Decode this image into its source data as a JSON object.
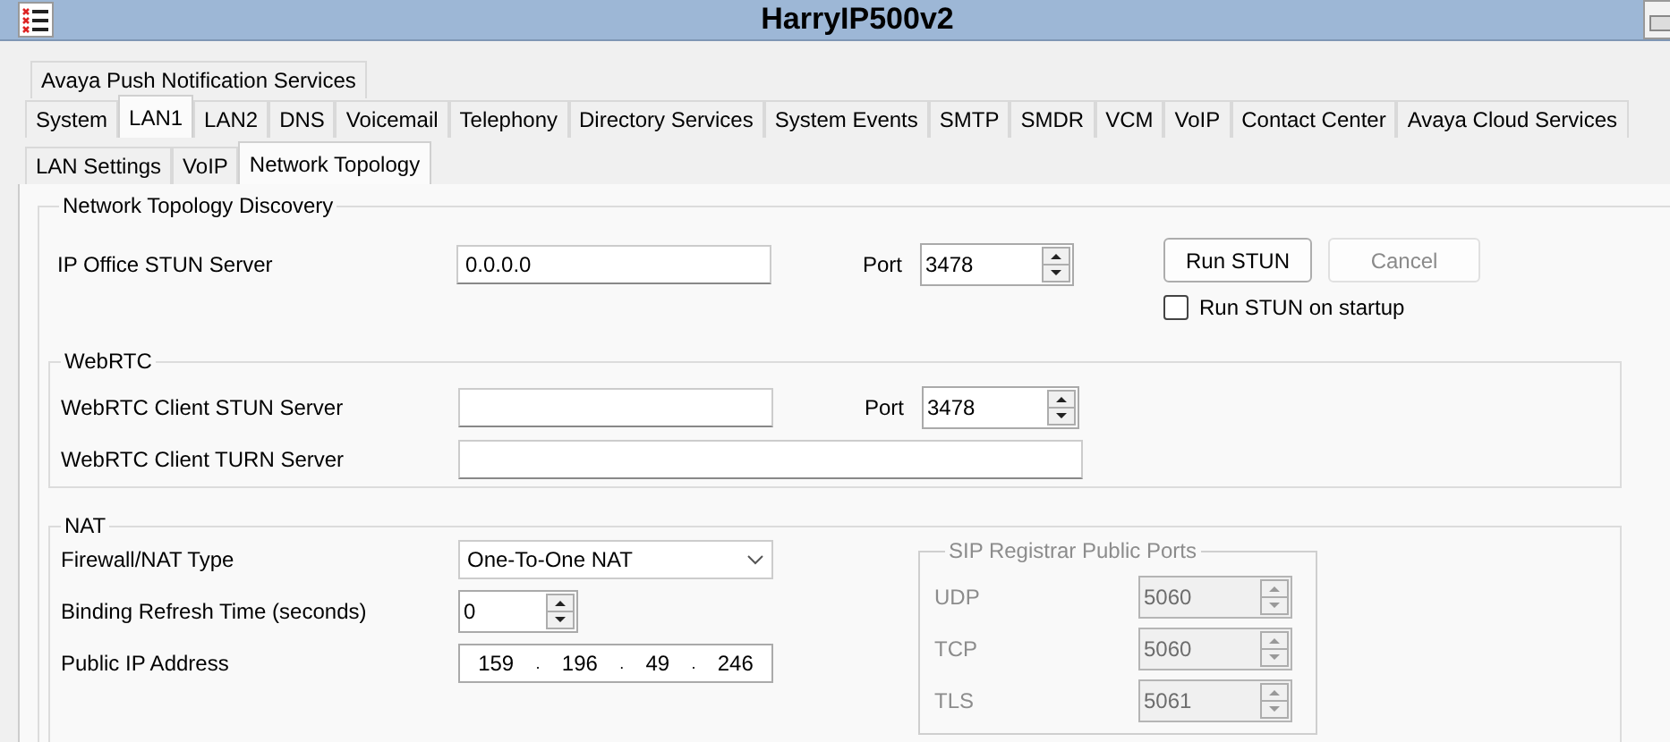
{
  "window": {
    "title": "HarryIP500v2"
  },
  "tab_rows": [
    [
      {
        "label": "Avaya Push Notification Services",
        "selected": false
      }
    ],
    [
      {
        "label": "System",
        "selected": false
      },
      {
        "label": "LAN1",
        "selected": true
      },
      {
        "label": "LAN2",
        "selected": false
      },
      {
        "label": "DNS",
        "selected": false
      },
      {
        "label": "Voicemail",
        "selected": false
      },
      {
        "label": "Telephony",
        "selected": false
      },
      {
        "label": "Directory Services",
        "selected": false
      },
      {
        "label": "System Events",
        "selected": false
      },
      {
        "label": "SMTP",
        "selected": false
      },
      {
        "label": "SMDR",
        "selected": false
      },
      {
        "label": "VCM",
        "selected": false
      },
      {
        "label": "VoIP",
        "selected": false
      },
      {
        "label": "Contact Center",
        "selected": false
      },
      {
        "label": "Avaya Cloud Services",
        "selected": false
      }
    ]
  ],
  "subtabs": [
    {
      "label": "LAN Settings",
      "selected": false
    },
    {
      "label": "VoIP",
      "selected": false
    },
    {
      "label": "Network Topology",
      "selected": true
    }
  ],
  "discovery": {
    "title": "Network Topology Discovery",
    "stun_server": {
      "label": "IP Office STUN Server",
      "value": "0.0.0.0"
    },
    "port": {
      "label": "Port",
      "value": "3478"
    },
    "buttons": [
      {
        "label": "Run STUN",
        "disabled": false
      },
      {
        "label": "Cancel",
        "disabled": true
      }
    ],
    "run_on_startup": {
      "label": "Run STUN on startup",
      "checked": false
    }
  },
  "webrtc": {
    "title": "WebRTC",
    "stun_server": {
      "label": "WebRTC Client STUN Server"
    },
    "port": {
      "label": "Port",
      "value": "3478"
    },
    "turn_server": {
      "label": "WebRTC Client TURN Server"
    }
  },
  "nat": {
    "title": "NAT",
    "firewall_type": {
      "label": "Firewall/NAT Type",
      "value": "One-To-One NAT"
    },
    "binding_refresh": {
      "label": "Binding Refresh Time (seconds)",
      "value": "0"
    },
    "public_ip": {
      "label": "Public IP Address",
      "octets": [
        "159",
        "196",
        "49",
        "246"
      ],
      "separator": "."
    },
    "sip_ports": {
      "title": "SIP Registrar Public Ports",
      "disabled": true,
      "ports": [
        {
          "label": "UDP",
          "value": "5060"
        },
        {
          "label": "TCP",
          "value": "5060"
        },
        {
          "label": "TLS",
          "value": "5061"
        }
      ]
    }
  }
}
